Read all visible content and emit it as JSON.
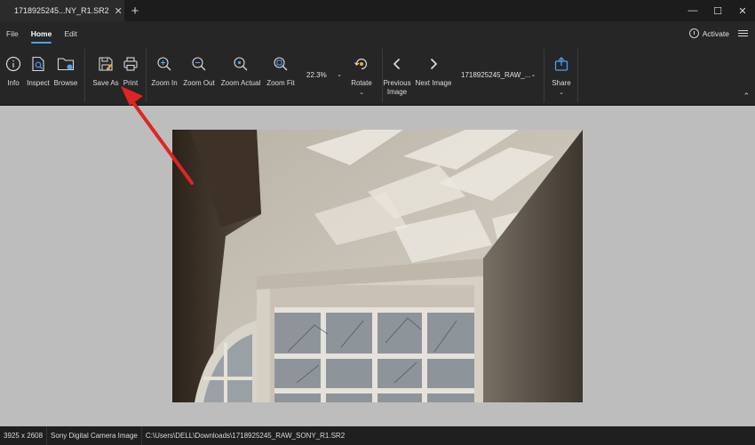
{
  "window": {
    "tab_title": "1718925245...NY_R1.SR2",
    "tab_close": "✕",
    "new_tab": "+",
    "minimize": "—",
    "maximize": "☐",
    "close": "✕"
  },
  "menu": {
    "items": [
      "File",
      "Home",
      "Edit"
    ],
    "active": "Home",
    "activate_label": "Activate"
  },
  "toolbar": {
    "info": "Info",
    "inspect": "Inspect",
    "browse": "Browse",
    "save_as": "Save As",
    "print": "Print",
    "zoom_in": "Zoom In",
    "zoom_out": "Zoom Out",
    "zoom_actual": "Zoom Actual",
    "zoom_fit": "Zoom Fit",
    "zoom_level": "22.3%",
    "rotate": "Rotate",
    "previous_image": "Previous Image",
    "next_image": "Next Image",
    "file_selector": "1718925245_RAW_...",
    "share": "Share",
    "chevron": "⌄",
    "collapse": "⌃"
  },
  "status": {
    "dimensions": "3925 x 2608",
    "file_type": "Sony Digital Camera Image",
    "path": "C:\\Users\\DELL\\Downloads\\1718925245_RAW_SONY_R1.SR2"
  },
  "colors": {
    "accent": "#4aa3ff",
    "annotation_arrow": "#e02424",
    "chrome_bg": "#262626",
    "canvas_bg": "#bdbdbd"
  }
}
